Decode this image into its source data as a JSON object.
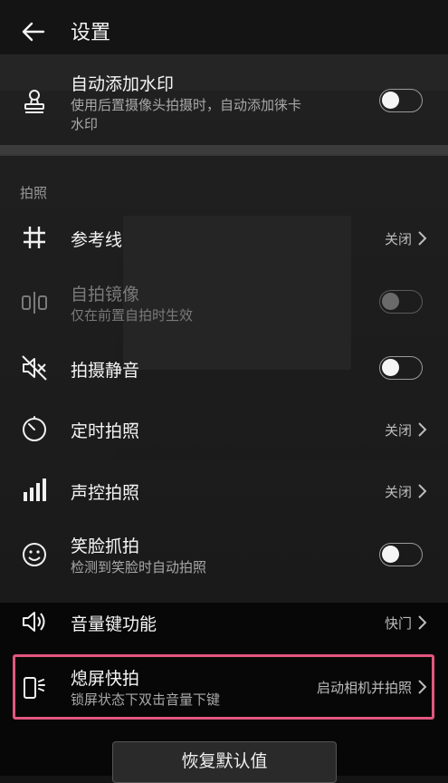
{
  "header": {
    "title": "设置"
  },
  "watermark": {
    "title": "自动添加水印",
    "subtitle_line1": "使用后置摄像头拍摄时，自动添加徕卡",
    "subtitle_line2": "水印",
    "enabled": false
  },
  "section": {
    "label": "拍照"
  },
  "settings": [
    {
      "title": "参考线",
      "value": "关闭"
    },
    {
      "title": "自拍镜像",
      "subtitle": "仅在前置自拍时生效",
      "enabled": false,
      "disabled": true
    },
    {
      "title": "拍摄静音",
      "enabled": false
    },
    {
      "title": "定时拍照",
      "value": "关闭"
    },
    {
      "title": "声控拍照",
      "value": "关闭"
    },
    {
      "title": "笑脸抓拍",
      "subtitle": "检测到笑脸时自动拍照",
      "enabled": false
    },
    {
      "title": "音量键功能",
      "value": "快门"
    },
    {
      "title": "熄屏快拍",
      "subtitle": "锁屏状态下双击音量下键",
      "value": "启动相机并拍照"
    }
  ],
  "reset": {
    "label": "恢复默认值"
  },
  "colors": {
    "highlight": "#e0577f",
    "background": "#141414"
  },
  "icons": [
    "back-arrow-icon",
    "stamp-icon",
    "grid-icon",
    "mirror-icon",
    "mute-icon",
    "timer-icon",
    "signal-bars-icon",
    "smile-icon",
    "volume-icon",
    "phone-quick-snap-icon",
    "chevron-right-icon"
  ]
}
